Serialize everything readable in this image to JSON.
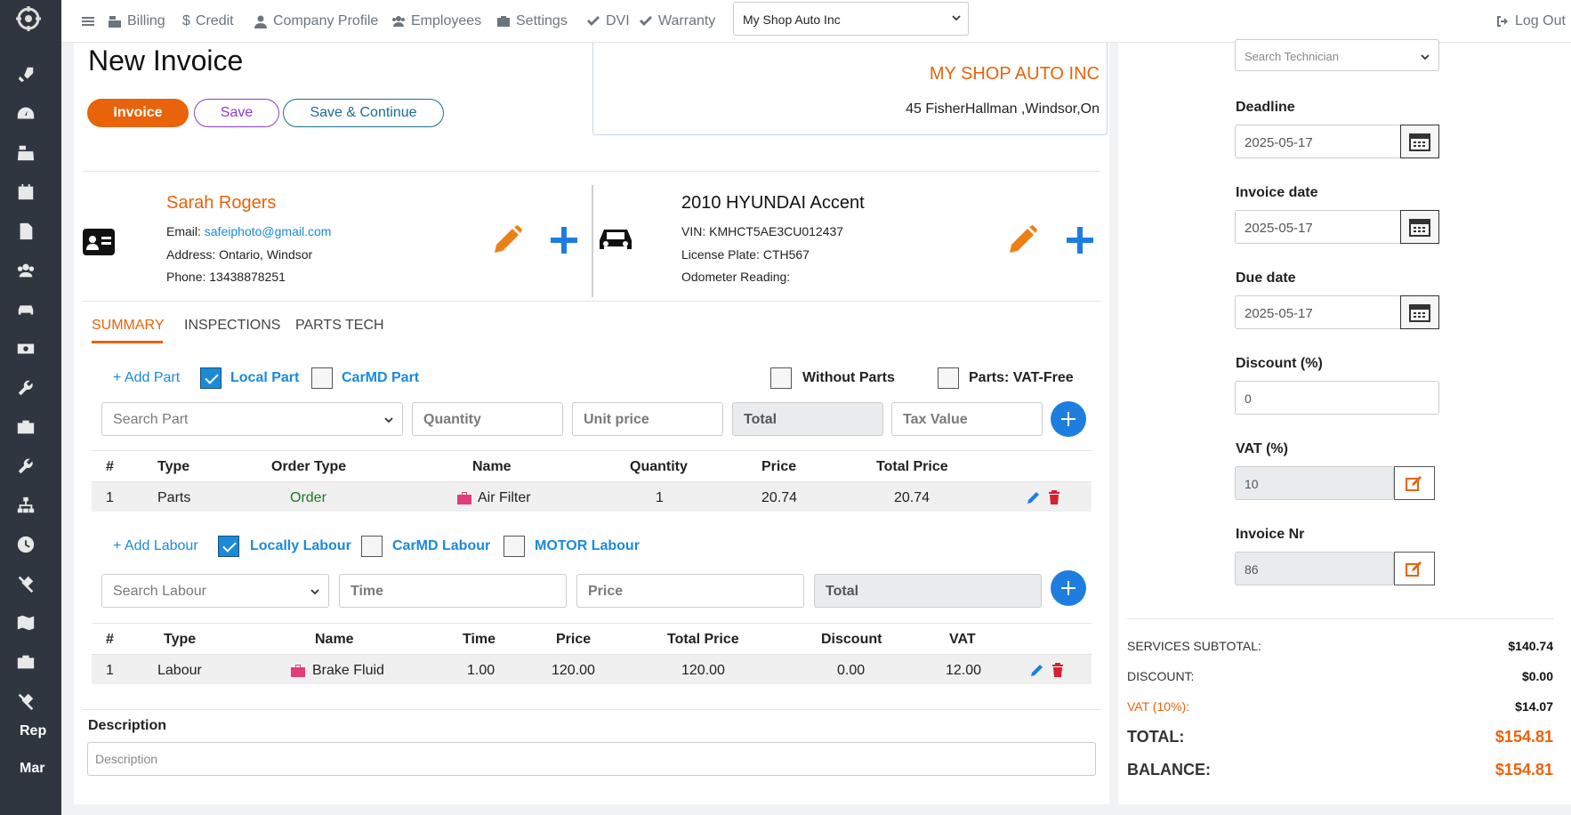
{
  "nav": {
    "billing": "Billing",
    "credit": "Credit",
    "company_profile": "Company Profile",
    "employees": "Employees",
    "settings": "Settings",
    "dvi": "DVI",
    "warranty": "Warranty",
    "shop_select": "My Shop Auto Inc",
    "logout": "Log Out"
  },
  "sidebar": {
    "rep": "Rep",
    "mar": "Mar"
  },
  "page": {
    "title": "New Invoice"
  },
  "buttons": {
    "invoice": "Invoice",
    "save": "Save",
    "save_continue": "Save & Continue"
  },
  "shop": {
    "name": "MY SHOP AUTO INC",
    "address": "45 FisherHallman ,Windsor,On"
  },
  "customer": {
    "name": "Sarah Rogers",
    "email_label": "Email: ",
    "email": "safeiphoto@gmail.com",
    "address": "Address: Ontario, Windsor",
    "phone": "Phone: 13438878251"
  },
  "vehicle": {
    "title": "2010 HYUNDAI Accent",
    "vin": "VIN: KMHCT5AE3CU012437",
    "plate": "License Plate: CTH567",
    "odometer": "Odometer Reading:"
  },
  "tabs": {
    "summary": "SUMMARY",
    "inspections": "INSPECTIONS",
    "parts_tech": "PARTS TECH"
  },
  "parts": {
    "add": "+ Add Part",
    "local": "Local Part",
    "carmd": "CarMD Part",
    "without": "Without Parts",
    "vat_free": "Parts: VAT-Free",
    "search_ph": "Search Part",
    "quantity_ph": "Quantity",
    "unit_price_ph": "Unit price",
    "total_ph": "Total",
    "tax_ph": "Tax Value",
    "headers": [
      "#",
      "Type",
      "Order Type",
      "Name",
      "Quantity",
      "Price",
      "Total Price"
    ],
    "row": {
      "num": "1",
      "type": "Parts",
      "order_type": "Order",
      "name": "Air Filter",
      "qty": "1",
      "price": "20.74",
      "total": "20.74"
    }
  },
  "labour": {
    "add": "+ Add Labour",
    "local": "Locally Labour",
    "carmd": "CarMD Labour",
    "motor": "MOTOR Labour",
    "search_ph": "Search Labour",
    "time_ph": "Time",
    "price_ph": "Price",
    "total_ph": "Total",
    "headers": [
      "#",
      "Type",
      "Name",
      "Time",
      "Price",
      "Total Price",
      "Discount",
      "VAT"
    ],
    "row": {
      "num": "1",
      "type": "Labour",
      "name": "Brake Fluid",
      "time": "1.00",
      "price": "120.00",
      "total": "120.00",
      "discount": "0.00",
      "vat": "12.00"
    }
  },
  "description": {
    "label": "Description",
    "placeholder": "Description"
  },
  "right": {
    "technician_ph": "Search Technician",
    "deadline_label": "Deadline",
    "deadline": "2025-05-17",
    "invoice_date_label": "Invoice date",
    "invoice_date": "2025-05-17",
    "due_date_label": "Due date",
    "due_date": "2025-05-17",
    "discount_label": "Discount (%)",
    "discount": "0",
    "vat_label": "VAT (%)",
    "vat": "10",
    "invoice_nr_label": "Invoice Nr",
    "invoice_nr": "86"
  },
  "totals": {
    "subtotal_label": "SERVICES SUBTOTAL:",
    "subtotal": "$140.74",
    "discount_label": "DISCOUNT:",
    "discount": "$0.00",
    "vat_label": "VAT (10%):",
    "vat": "$14.07",
    "total_label": "TOTAL:",
    "total": "$154.81",
    "balance_label": "BALANCE:",
    "balance": "$154.81"
  },
  "colors": {
    "accent": "#e8630a",
    "link": "#1b8ad8",
    "primary": "#1e7ee0",
    "sidebar": "#2f3640"
  }
}
